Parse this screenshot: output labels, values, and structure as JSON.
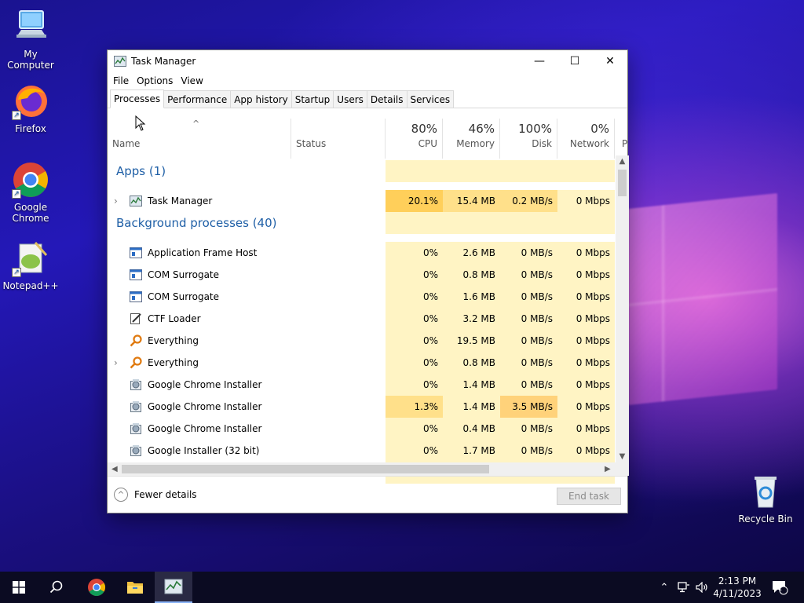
{
  "desktop": {
    "icons": [
      {
        "label": "My Computer"
      },
      {
        "label": "Firefox"
      },
      {
        "label": "Google\nChrome"
      },
      {
        "label": "Notepad++"
      },
      {
        "label": "Recycle Bin"
      }
    ]
  },
  "window": {
    "title": "Task Manager",
    "minimize_glyph": "—",
    "maximize_glyph": "☐",
    "close_glyph": "✕"
  },
  "menu": [
    "File",
    "Options",
    "View"
  ],
  "tabs": [
    "Processes",
    "Performance",
    "App history",
    "Startup",
    "Users",
    "Details",
    "Services"
  ],
  "active_tab": "Processes",
  "columns": {
    "name": "Name",
    "status": "Status",
    "cpu": {
      "pct": "80%",
      "label": "CPU"
    },
    "memory": {
      "pct": "46%",
      "label": "Memory"
    },
    "disk": {
      "pct": "100%",
      "label": "Disk"
    },
    "network": {
      "pct": "0%",
      "label": "Network"
    },
    "power_partial": "P"
  },
  "groups": [
    {
      "title": "Apps (1)"
    },
    {
      "title": "Background processes (40)"
    }
  ],
  "processes": [
    {
      "name": "Task Manager",
      "icon": "task-manager-icon",
      "expandable": true,
      "cpu": "20.1%",
      "memory": "15.4 MB",
      "disk": "0.2 MB/s",
      "network": "0 Mbps",
      "group": 0
    },
    {
      "name": "Application Frame Host",
      "icon": "window-app-icon",
      "expandable": false,
      "cpu": "0%",
      "memory": "2.6 MB",
      "disk": "0 MB/s",
      "network": "0 Mbps",
      "group": 1
    },
    {
      "name": "COM Surrogate",
      "icon": "window-app-icon",
      "expandable": false,
      "cpu": "0%",
      "memory": "0.8 MB",
      "disk": "0 MB/s",
      "network": "0 Mbps",
      "group": 1
    },
    {
      "name": "COM Surrogate",
      "icon": "window-app-icon",
      "expandable": false,
      "cpu": "0%",
      "memory": "1.6 MB",
      "disk": "0 MB/s",
      "network": "0 Mbps",
      "group": 1
    },
    {
      "name": "CTF Loader",
      "icon": "ctf-loader-icon",
      "expandable": false,
      "cpu": "0%",
      "memory": "3.2 MB",
      "disk": "0 MB/s",
      "network": "0 Mbps",
      "group": 1
    },
    {
      "name": "Everything",
      "icon": "everything-search-icon",
      "expandable": false,
      "cpu": "0%",
      "memory": "19.5 MB",
      "disk": "0 MB/s",
      "network": "0 Mbps",
      "group": 1
    },
    {
      "name": "Everything",
      "icon": "everything-search-icon",
      "expandable": true,
      "cpu": "0%",
      "memory": "0.8 MB",
      "disk": "0 MB/s",
      "network": "0 Mbps",
      "group": 1
    },
    {
      "name": "Google Chrome Installer",
      "icon": "installer-icon",
      "expandable": false,
      "cpu": "0%",
      "memory": "1.4 MB",
      "disk": "0 MB/s",
      "network": "0 Mbps",
      "group": 1
    },
    {
      "name": "Google Chrome Installer",
      "icon": "installer-icon",
      "expandable": false,
      "cpu": "1.3%",
      "memory": "1.4 MB",
      "disk": "3.5 MB/s",
      "network": "0 Mbps",
      "group": 1
    },
    {
      "name": "Google Chrome Installer",
      "icon": "installer-icon",
      "expandable": false,
      "cpu": "0%",
      "memory": "0.4 MB",
      "disk": "0 MB/s",
      "network": "0 Mbps",
      "group": 1
    },
    {
      "name": "Google Installer (32 bit)",
      "icon": "installer-icon",
      "expandable": false,
      "cpu": "0%",
      "memory": "1.7 MB",
      "disk": "0 MB/s",
      "network": "0 Mbps",
      "group": 1
    }
  ],
  "footer": {
    "fewer_details": "Fewer details",
    "end_task": "End task"
  },
  "taskbar": {
    "time": "2:13 PM",
    "date": "4/11/2023",
    "notification_count": "1"
  },
  "colors": {
    "group_title": "#1f5fa6",
    "heat_light": "#fff4c4",
    "heat_medium": "#ffe08a",
    "heat_strong": "#ffd27a",
    "heat_cpu_top": "#ffcf5a"
  }
}
